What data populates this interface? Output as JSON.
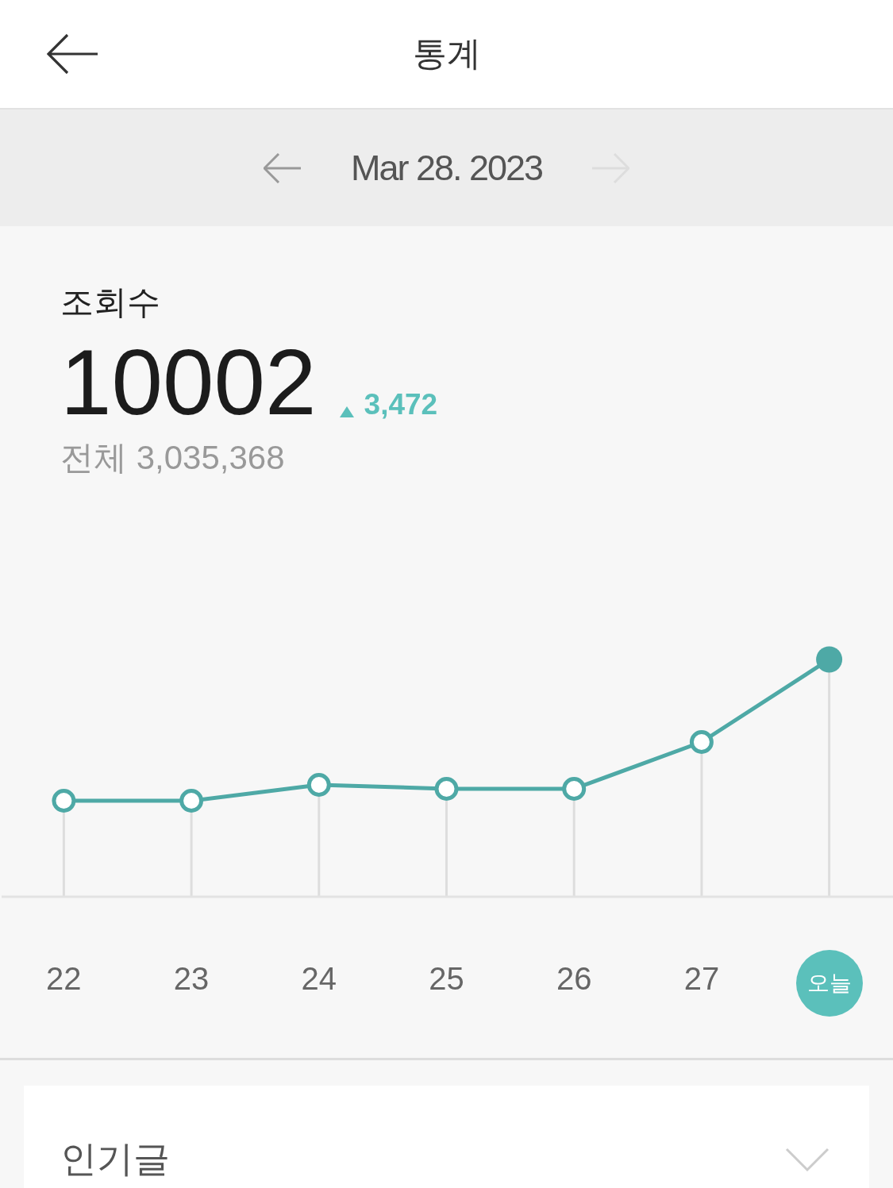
{
  "header": {
    "title": "통계"
  },
  "date_nav": {
    "date": "Mar 28. 2023",
    "prev": {
      "disabled": false
    },
    "next": {
      "disabled": true
    }
  },
  "stats": {
    "label": "조회수",
    "value": "10002",
    "rising": true,
    "change": "3,472",
    "total": "전체 3,035,368"
  },
  "chart": {
    "days": [
      {
        "label": "22",
        "selected": false
      },
      {
        "label": "23",
        "selected": false
      },
      {
        "label": "24",
        "selected": false
      },
      {
        "label": "25",
        "selected": false
      },
      {
        "label": "26",
        "selected": false
      },
      {
        "label": "27",
        "selected": false
      },
      {
        "label": "오늘",
        "selected": true
      }
    ]
  },
  "popular_posts": {
    "title": "인기글",
    "expanded": false
  }
}
